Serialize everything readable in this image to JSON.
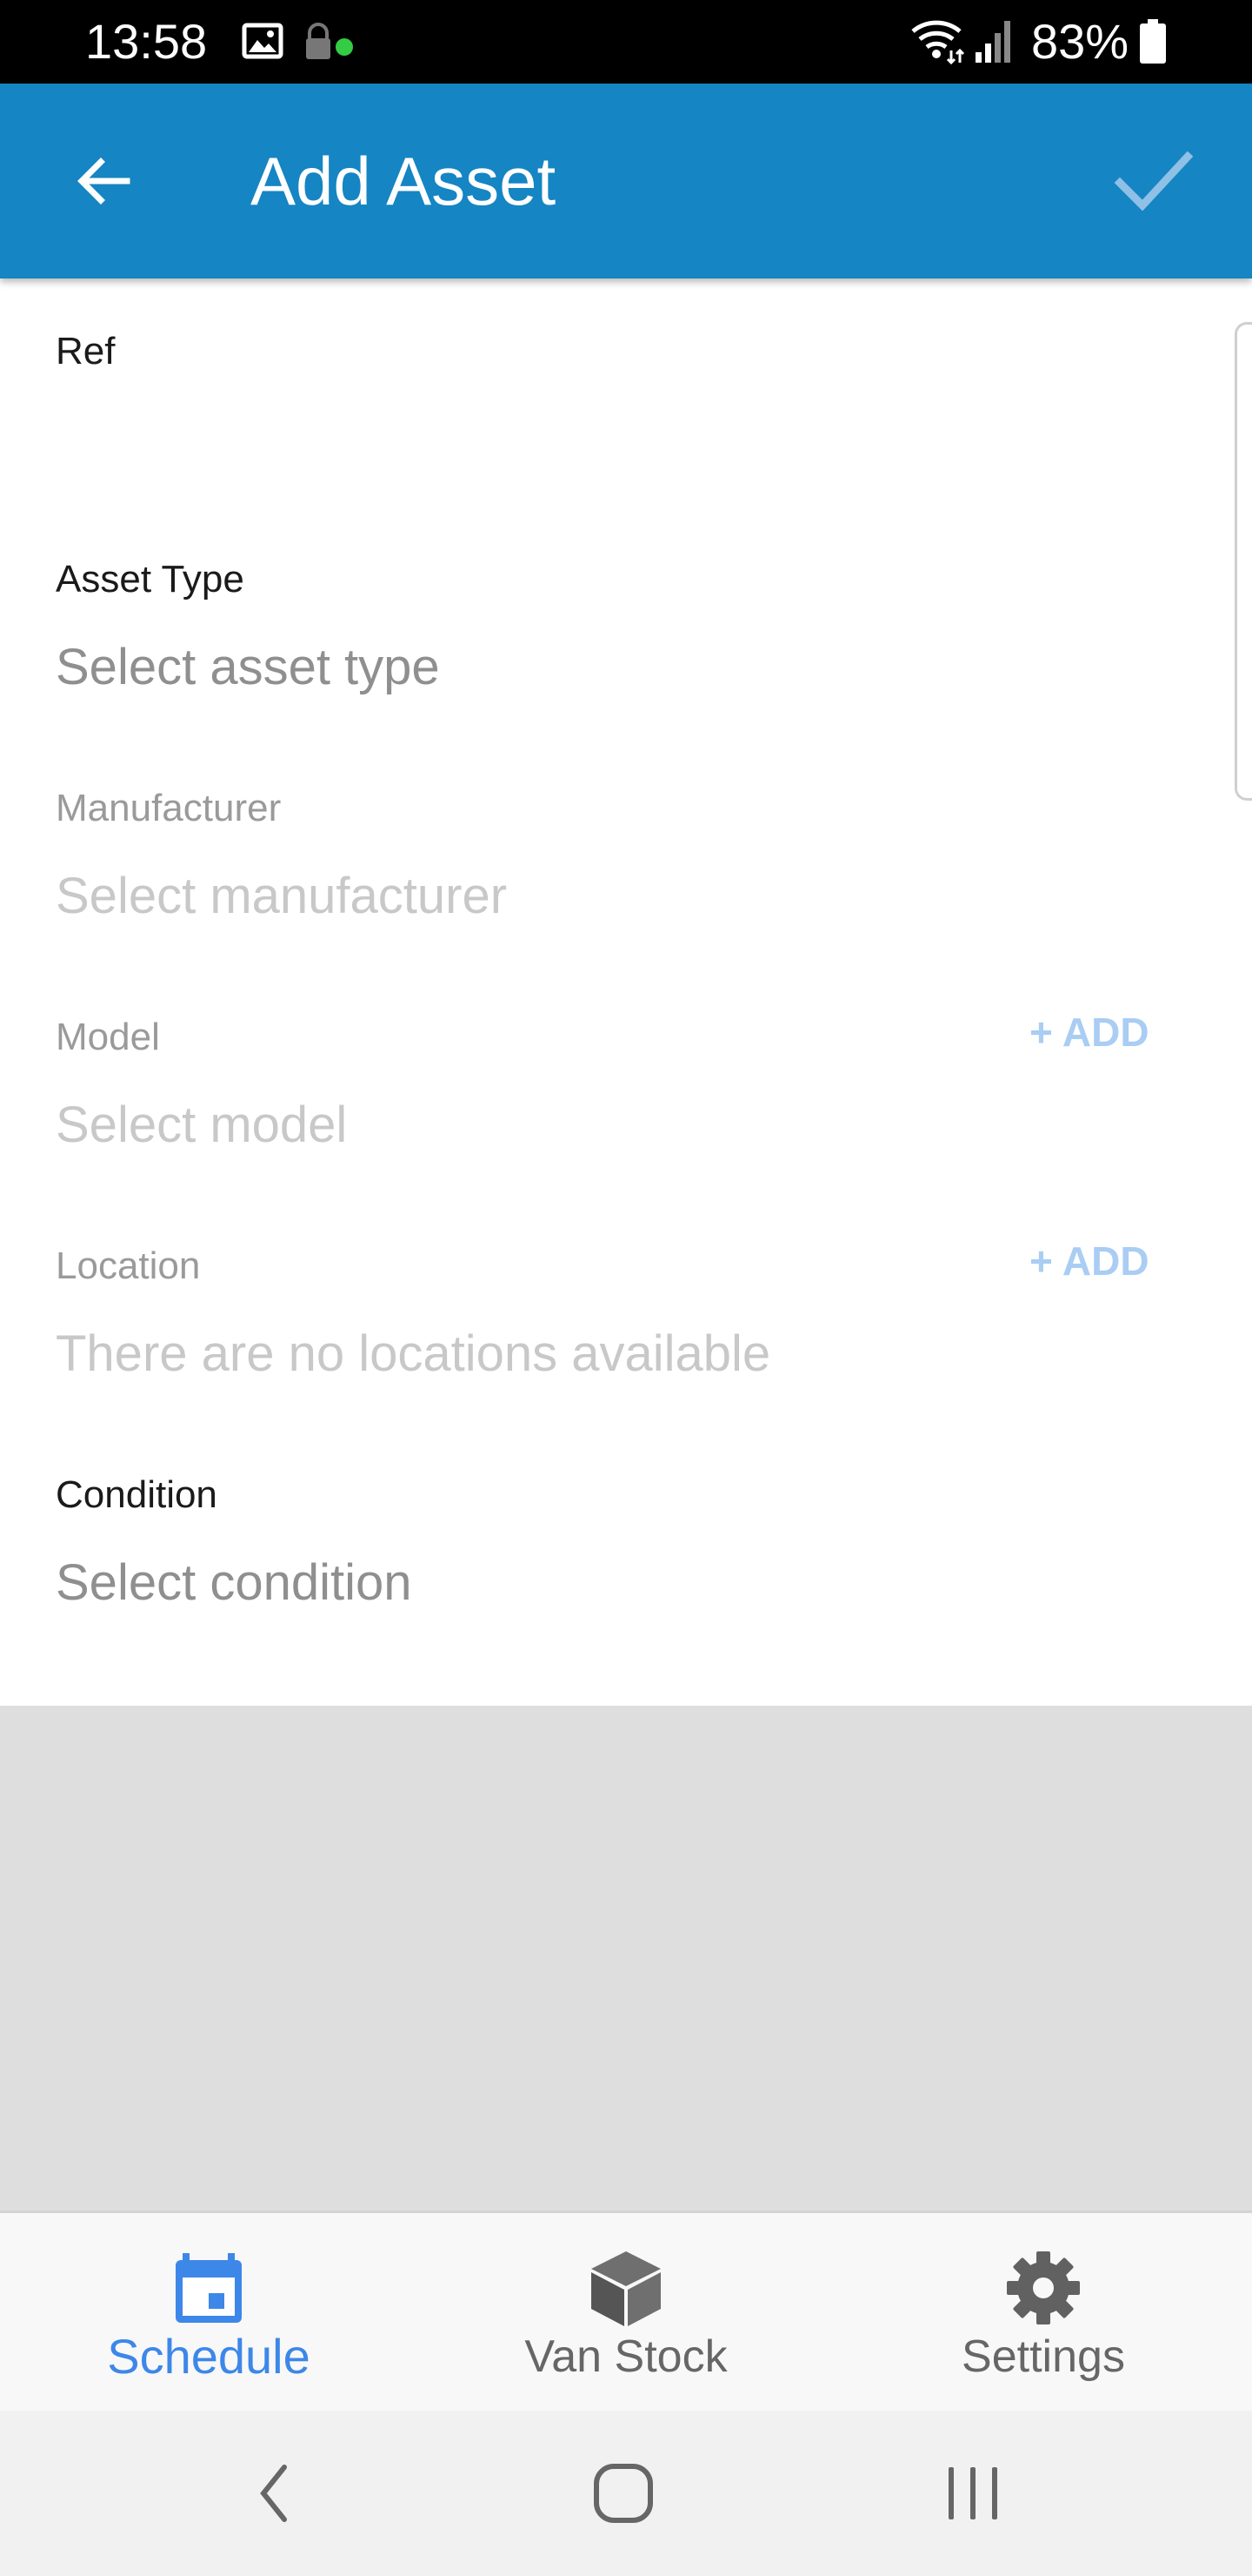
{
  "status_bar": {
    "time": "13:58",
    "battery_percent": "83%",
    "icons": [
      "image-icon",
      "vpn-icon",
      "wifi-icon",
      "signal-icon",
      "battery-icon"
    ]
  },
  "app_bar": {
    "title": "Add Asset",
    "back_icon": "arrow-back-icon",
    "save_icon": "check-icon"
  },
  "form": {
    "ref": {
      "label": "Ref",
      "value": ""
    },
    "asset_type": {
      "label": "Asset Type",
      "placeholder": "Select asset type"
    },
    "manufacturer": {
      "label": "Manufacturer",
      "placeholder": "Select manufacturer"
    },
    "model": {
      "label": "Model",
      "placeholder": "Select model",
      "add_label": "+ ADD"
    },
    "location": {
      "label": "Location",
      "placeholder": "There are no locations available",
      "add_label": "+ ADD"
    },
    "condition": {
      "label": "Condition",
      "placeholder": "Select condition"
    }
  },
  "bottom_nav": {
    "items": [
      {
        "label": "Schedule",
        "icon": "calendar-icon",
        "active": true
      },
      {
        "label": "Van Stock",
        "icon": "box-icon",
        "active": false
      },
      {
        "label": "Settings",
        "icon": "gear-icon",
        "active": false
      }
    ]
  },
  "colors": {
    "app_bar": "#1585c3",
    "active_nav": "#3d87e8",
    "add_link": "#a9cdf3",
    "empty_area": "#dedede"
  }
}
